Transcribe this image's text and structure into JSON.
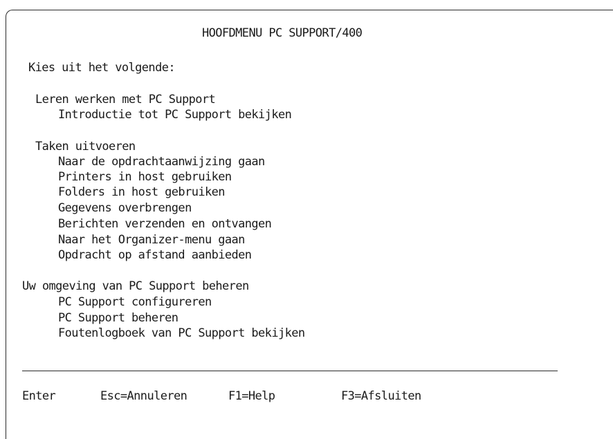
{
  "screen": {
    "title": "HOOFDMENU PC SUPPORT/400",
    "prompt": "Kies uit het volgende:"
  },
  "sections": [
    {
      "heading": "Leren werken met PC Support",
      "items": [
        "Introductie tot PC Support bekijken"
      ]
    },
    {
      "heading": "Taken uitvoeren",
      "items": [
        "Naar de opdrachtaanwijzing gaan",
        "Printers in host gebruiken",
        "Folders in host gebruiken",
        "Gegevens overbrengen",
        "Berichten verzenden en ontvangen",
        "Naar het Organizer-menu gaan",
        "Opdracht op afstand aanbieden"
      ]
    },
    {
      "heading": "Uw omgeving van PC Support beheren",
      "items": [
        "PC Support configureren",
        "PC Support beheren",
        "Foutenlogboek van PC Support bekijken"
      ]
    }
  ],
  "function_keys": {
    "enter": "Enter",
    "esc": "Esc=Annuleren",
    "f1": "F1=Help",
    "f3": "F3=Afsluiten"
  }
}
